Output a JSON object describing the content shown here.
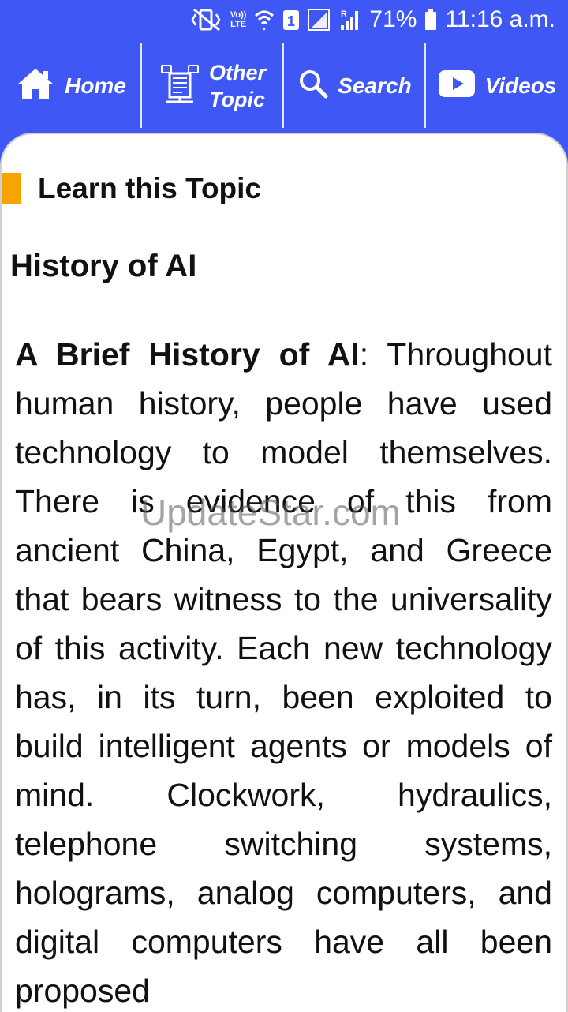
{
  "status_bar": {
    "volte_top": "Vo))",
    "volte_bottom": "LTE",
    "sim_badge": "1",
    "roaming": "R",
    "battery": "71%",
    "time": "11:16 a.m."
  },
  "nav": {
    "home_label": "Home",
    "other_topic_line1": "Other",
    "other_topic_line2": "Topic",
    "search_label": "Search",
    "videos_label": "Videos"
  },
  "section": {
    "header": "Learn this Topic"
  },
  "topic": {
    "title": "History of AI",
    "lead_bold": "A Brief History of AI",
    "body": ": Throughout human history, people have used technology to model themselves. There is evidence of this from ancient China, Egypt, and Greece that bears witness to the universality of this activity. Each new technology has, in its turn, been exploited to build intelligent agents or models of mind. Clockwork, hydraulics, telephone switching systems, holograms, analog computers, and digital computers have all been proposed"
  },
  "watermark": "UpdateStar.com",
  "colors": {
    "brand_blue": "#3f57f5",
    "accent_orange": "#f5a400"
  },
  "icons": {
    "home": "home-icon",
    "other_topic": "topic-board-icon",
    "search": "search-icon",
    "videos": "play-icon"
  }
}
